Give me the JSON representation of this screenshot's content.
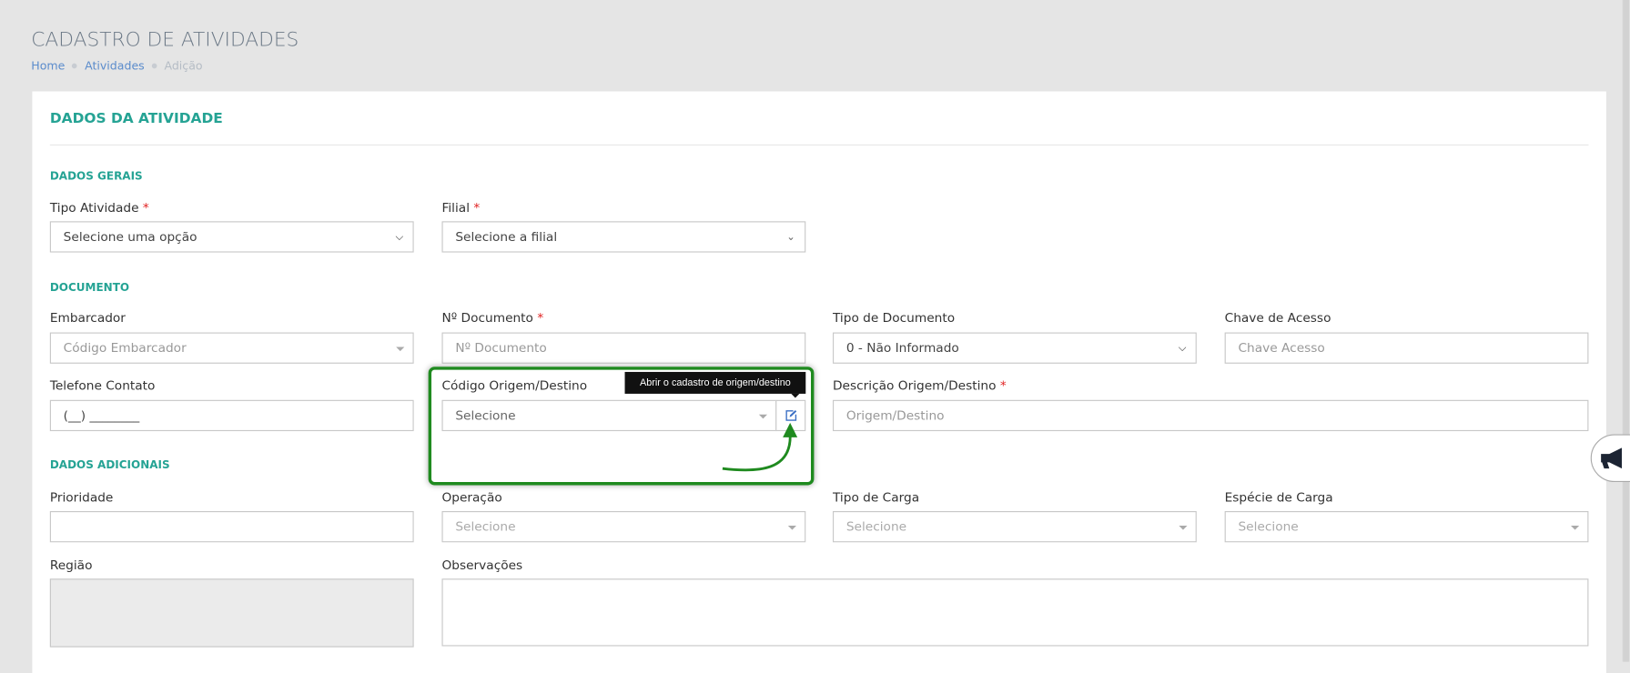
{
  "page": {
    "title": "CADASTRO DE ATIVIDADES",
    "breadcrumb": [
      "Home",
      "Atividades",
      "Adição"
    ]
  },
  "card": {
    "title": "DADOS DA ATIVIDADE"
  },
  "sections": {
    "gerais": "DADOS GERAIS",
    "documento": "DOCUMENTO",
    "adicionais": "DADOS ADICIONAIS"
  },
  "fields": {
    "tipo_atividade": {
      "label": "Tipo Atividade",
      "value": "Selecione uma opção"
    },
    "filial": {
      "label": "Filial",
      "value": "Selecione a filial"
    },
    "embarcador": {
      "label": "Embarcador",
      "placeholder": "Código Embarcador"
    },
    "n_documento": {
      "label": "Nº Documento",
      "placeholder": "Nº Documento"
    },
    "tipo_documento": {
      "label": "Tipo de Documento",
      "value": "0 - Não Informado"
    },
    "chave_acesso": {
      "label": "Chave de Acesso",
      "placeholder": "Chave Acesso"
    },
    "telefone": {
      "label": "Telefone Contato",
      "value": "(__) ________"
    },
    "codigo_origem": {
      "label": "Código Origem/Destino",
      "placeholder": "Selecione"
    },
    "descricao_origem": {
      "label": "Descrição Origem/Destino",
      "placeholder": "Origem/Destino"
    },
    "prioridade": {
      "label": "Prioridade",
      "value": ""
    },
    "operacao": {
      "label": "Operação",
      "placeholder": "Selecione"
    },
    "tipo_carga": {
      "label": "Tipo de Carga",
      "placeholder": "Selecione"
    },
    "especie_carga": {
      "label": "Espécie de Carga",
      "placeholder": "Selecione"
    },
    "regiao": {
      "label": "Região"
    },
    "observacoes": {
      "label": "Observações"
    }
  },
  "required_mark": "*",
  "tooltip": "Abrir o cadastro de origem/destino",
  "colors": {
    "accent": "#25a394",
    "highlight": "#1f8a1f"
  }
}
